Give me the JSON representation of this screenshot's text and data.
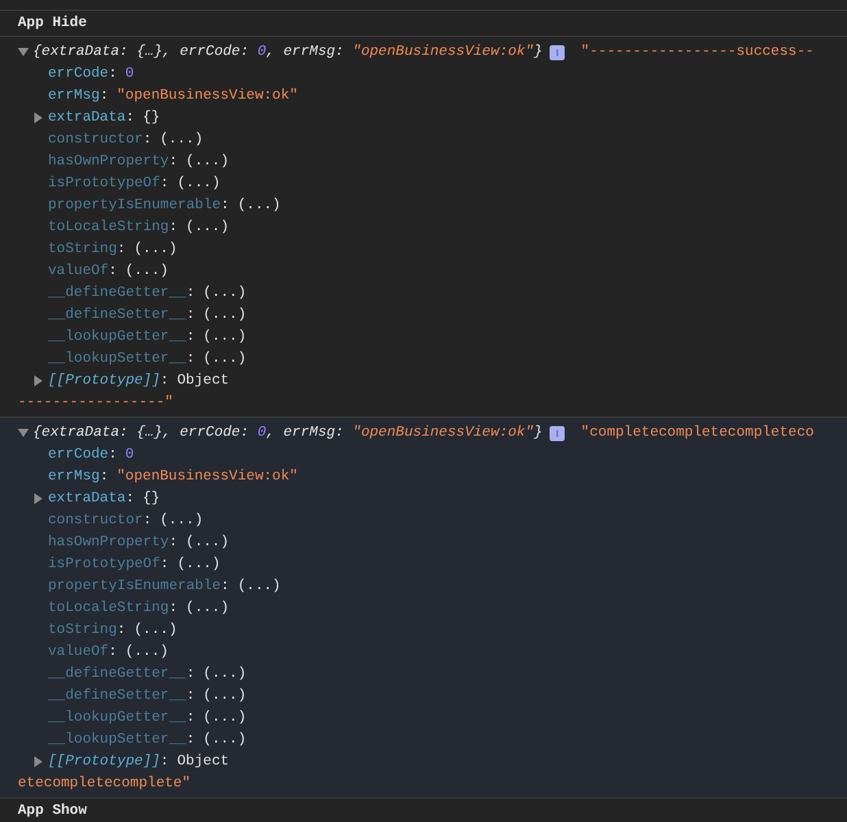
{
  "messages": [
    {
      "kind": "text",
      "text": "App Hide",
      "highlighted": false
    },
    {
      "kind": "object",
      "highlighted": false,
      "expanded": true,
      "summary": [
        {
          "kind": "punct",
          "text": "{extraData: {…}, errCode: "
        },
        {
          "kind": "number",
          "text": "0"
        },
        {
          "kind": "punct",
          "text": ", errMsg: "
        },
        {
          "kind": "string",
          "text": "\"openBusinessView:ok\""
        },
        {
          "kind": "punct",
          "text": "}"
        }
      ],
      "string_head": "\"-----------------success--",
      "string_tail": "-----------------\"",
      "properties": [
        {
          "name": "errCode:",
          "value": {
            "kind": "number",
            "text": "0"
          },
          "kind": "own",
          "expandable": false
        },
        {
          "name": "errMsg:",
          "value": {
            "kind": "string",
            "text": "\"openBusinessView:ok\""
          },
          "kind": "own",
          "expandable": false
        },
        {
          "name": "extraData:",
          "value": {
            "kind": "plain",
            "text": "{}"
          },
          "kind": "own",
          "expandable": true
        },
        {
          "name": "constructor:",
          "value": {
            "kind": "plain",
            "text": "(...)"
          },
          "kind": "inherited",
          "expandable": false
        },
        {
          "name": "hasOwnProperty:",
          "value": {
            "kind": "plain",
            "text": "(...)"
          },
          "kind": "inherited",
          "expandable": false
        },
        {
          "name": "isPrototypeOf:",
          "value": {
            "kind": "plain",
            "text": "(...)"
          },
          "kind": "inherited",
          "expandable": false
        },
        {
          "name": "propertyIsEnumerable:",
          "value": {
            "kind": "plain",
            "text": "(...)"
          },
          "kind": "inherited",
          "expandable": false
        },
        {
          "name": "toLocaleString:",
          "value": {
            "kind": "plain",
            "text": "(...)"
          },
          "kind": "inherited",
          "expandable": false
        },
        {
          "name": "toString:",
          "value": {
            "kind": "plain",
            "text": "(...)"
          },
          "kind": "inherited",
          "expandable": false
        },
        {
          "name": "valueOf:",
          "value": {
            "kind": "plain",
            "text": "(...)"
          },
          "kind": "inherited",
          "expandable": false
        },
        {
          "name": "__defineGetter__:",
          "value": {
            "kind": "plain",
            "text": "(...)"
          },
          "kind": "inherited",
          "expandable": false
        },
        {
          "name": "__defineSetter__:",
          "value": {
            "kind": "plain",
            "text": "(...)"
          },
          "kind": "inherited",
          "expandable": false
        },
        {
          "name": "__lookupGetter__:",
          "value": {
            "kind": "plain",
            "text": "(...)"
          },
          "kind": "inherited",
          "expandable": false
        },
        {
          "name": "__lookupSetter__:",
          "value": {
            "kind": "plain",
            "text": "(...)"
          },
          "kind": "inherited",
          "expandable": false
        },
        {
          "name": "[[Prototype]]:",
          "value": {
            "kind": "plain",
            "text": "Object"
          },
          "kind": "prototype",
          "expandable": true
        }
      ]
    },
    {
      "kind": "object",
      "highlighted": true,
      "expanded": true,
      "summary": [
        {
          "kind": "punct",
          "text": "{extraData: {…}, errCode: "
        },
        {
          "kind": "number",
          "text": "0"
        },
        {
          "kind": "punct",
          "text": ", errMsg: "
        },
        {
          "kind": "string",
          "text": "\"openBusinessView:ok\""
        },
        {
          "kind": "punct",
          "text": "}"
        }
      ],
      "string_head": "\"completecompletecompleteco",
      "string_tail": "etecompletecomplete\"",
      "properties": [
        {
          "name": "errCode:",
          "value": {
            "kind": "number",
            "text": "0"
          },
          "kind": "own",
          "expandable": false
        },
        {
          "name": "errMsg:",
          "value": {
            "kind": "string",
            "text": "\"openBusinessView:ok\""
          },
          "kind": "own",
          "expandable": false
        },
        {
          "name": "extraData:",
          "value": {
            "kind": "plain",
            "text": "{}"
          },
          "kind": "own",
          "expandable": true
        },
        {
          "name": "constructor:",
          "value": {
            "kind": "plain",
            "text": "(...)"
          },
          "kind": "inherited",
          "expandable": false
        },
        {
          "name": "hasOwnProperty:",
          "value": {
            "kind": "plain",
            "text": "(...)"
          },
          "kind": "inherited",
          "expandable": false
        },
        {
          "name": "isPrototypeOf:",
          "value": {
            "kind": "plain",
            "text": "(...)"
          },
          "kind": "inherited",
          "expandable": false
        },
        {
          "name": "propertyIsEnumerable:",
          "value": {
            "kind": "plain",
            "text": "(...)"
          },
          "kind": "inherited",
          "expandable": false
        },
        {
          "name": "toLocaleString:",
          "value": {
            "kind": "plain",
            "text": "(...)"
          },
          "kind": "inherited",
          "expandable": false
        },
        {
          "name": "toString:",
          "value": {
            "kind": "plain",
            "text": "(...)"
          },
          "kind": "inherited",
          "expandable": false
        },
        {
          "name": "valueOf:",
          "value": {
            "kind": "plain",
            "text": "(...)"
          },
          "kind": "inherited",
          "expandable": false
        },
        {
          "name": "__defineGetter__:",
          "value": {
            "kind": "plain",
            "text": "(...)"
          },
          "kind": "inherited",
          "expandable": false
        },
        {
          "name": "__defineSetter__:",
          "value": {
            "kind": "plain",
            "text": "(...)"
          },
          "kind": "inherited",
          "expandable": false
        },
        {
          "name": "__lookupGetter__:",
          "value": {
            "kind": "plain",
            "text": "(...)"
          },
          "kind": "inherited",
          "expandable": false
        },
        {
          "name": "__lookupSetter__:",
          "value": {
            "kind": "plain",
            "text": "(...)"
          },
          "kind": "inherited",
          "expandable": false
        },
        {
          "name": "[[Prototype]]:",
          "value": {
            "kind": "plain",
            "text": "Object"
          },
          "kind": "prototype",
          "expandable": true
        }
      ]
    },
    {
      "kind": "text",
      "text": "App Show",
      "highlighted": false
    }
  ]
}
